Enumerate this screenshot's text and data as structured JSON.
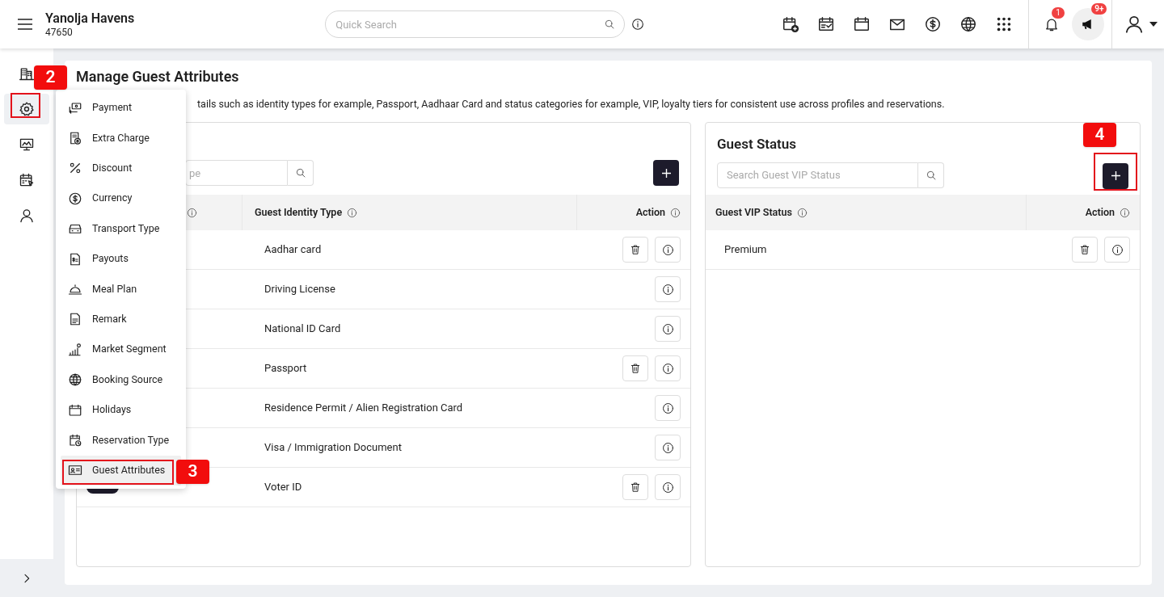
{
  "header": {
    "app_title": "Yanolja Havens",
    "property_id": "47650",
    "search": {
      "placeholder": "Quick Search"
    },
    "notifications_badge": "1",
    "announcements_badge": "9+"
  },
  "sidebar": {
    "items": [
      {
        "selected": false
      },
      {
        "selected": true
      },
      {
        "selected": false
      },
      {
        "selected": false
      },
      {
        "selected": false
      }
    ]
  },
  "settings_menu": {
    "items": [
      {
        "label": "Payment",
        "selected": false
      },
      {
        "label": "Extra Charge",
        "selected": false
      },
      {
        "label": "Discount",
        "selected": false
      },
      {
        "label": "Currency",
        "selected": false
      },
      {
        "label": "Transport Type",
        "selected": false
      },
      {
        "label": "Payouts",
        "selected": false
      },
      {
        "label": "Meal Plan",
        "selected": false
      },
      {
        "label": "Remark",
        "selected": false
      },
      {
        "label": "Market Segment",
        "selected": false
      },
      {
        "label": "Booking Source",
        "selected": false
      },
      {
        "label": "Holidays",
        "selected": false
      },
      {
        "label": "Reservation Type",
        "selected": false
      },
      {
        "label": "Guest Attributes",
        "selected": true
      }
    ]
  },
  "annotations": [
    {
      "label": "2"
    },
    {
      "label": "3"
    },
    {
      "label": "4"
    }
  ],
  "page": {
    "title": "Manage Guest Attributes",
    "description": "tails such as identity types for example, Passport, Aadhaar Card and status categories for example, VIP, loyalty tiers for consistent use across profiles and reservations."
  },
  "identity_panel": {
    "search": {
      "placeholder": "pe"
    },
    "columns": {
      "column_2": "Guest Identity Type",
      "action": "Action"
    },
    "rows": [
      {
        "name": "Aadhar card",
        "deletable": true
      },
      {
        "name": "Driving License",
        "deletable": false
      },
      {
        "name": "National ID Card",
        "deletable": false
      },
      {
        "name": "Passport",
        "deletable": true
      },
      {
        "name": "Residence Permit / Alien Registration Card",
        "deletable": false
      },
      {
        "name": "Visa / Immigration Document",
        "deletable": false
      },
      {
        "name": "Voter ID",
        "toggle_on": true,
        "deletable": true
      }
    ]
  },
  "status_panel": {
    "title": "Guest Status",
    "search": {
      "placeholder": "Search Guest VIP Status"
    },
    "columns": {
      "status": "Guest VIP Status",
      "action": "Action"
    },
    "rows": [
      {
        "name": "Premium",
        "deletable": true
      }
    ]
  }
}
